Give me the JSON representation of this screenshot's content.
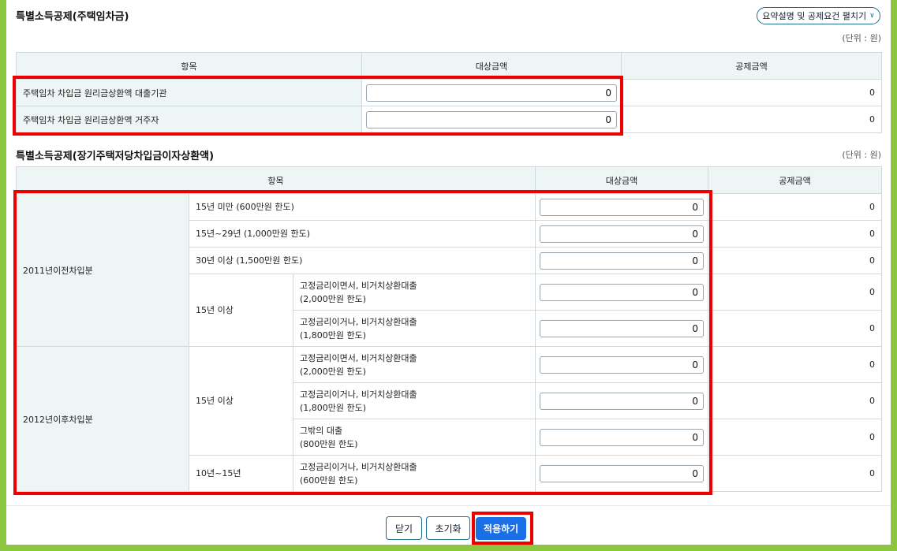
{
  "section1": {
    "title": "특별소득공제(주택임차금)",
    "toggle_label": "요약설명 및 공제요건 펼치기",
    "unit": "(단위 : 원)",
    "headers": [
      "항목",
      "대상금액",
      "공제금액"
    ],
    "rows": [
      {
        "label": "주택임차 차입금 원리금상환액 대출기관",
        "amount": "0",
        "deduction": "0"
      },
      {
        "label": "주택임차 차입금 원리금상환액 거주자",
        "amount": "0",
        "deduction": "0"
      }
    ]
  },
  "section2": {
    "title": "특별소득공제(장기주택저당차입금이자상환액)",
    "unit": "(단위 : 원)",
    "headers": [
      "항목",
      "대상금액",
      "공제금액"
    ],
    "group_2011": "2011년이전차입분",
    "group_2012": "2012년이후차입분",
    "r1": {
      "label": "15년 미만 (600만원 한도)",
      "amount": "0",
      "deduction": "0"
    },
    "r2": {
      "label": "15년~29년 (1,000만원 한도)",
      "amount": "0",
      "deduction": "0"
    },
    "r3": {
      "label": "30년 이상 (1,500만원 한도)",
      "amount": "0",
      "deduction": "0"
    },
    "sub_15_a": "15년 이상",
    "r4": {
      "line1": "고정금리이면서, 비거치상환대출",
      "line2": "(2,000만원 한도)",
      "amount": "0",
      "deduction": "0"
    },
    "r5": {
      "line1": "고정금리이거나, 비거치상환대출",
      "line2": "(1,800만원 한도)",
      "amount": "0",
      "deduction": "0"
    },
    "sub_15_b": "15년 이상",
    "r6": {
      "line1": "고정금리이면서, 비거치상환대출",
      "line2": "(2,000만원 한도)",
      "amount": "0",
      "deduction": "0"
    },
    "r7": {
      "line1": "고정금리이거나, 비거치상환대출",
      "line2": "(1,800만원 한도)",
      "amount": "0",
      "deduction": "0"
    },
    "r8": {
      "line1": "그밖의 대출",
      "line2": "(800만원 한도)",
      "amount": "0",
      "deduction": "0"
    },
    "sub_10": "10년~15년",
    "r9": {
      "line1": "고정금리이거나, 비거치상환대출",
      "line2": "(600만원 한도)",
      "amount": "0",
      "deduction": "0"
    }
  },
  "footer": {
    "close_label": "닫기",
    "reset_label": "초기화",
    "apply_label": "적용하기"
  },
  "colors": {
    "frame": "#8cc63f",
    "highlight": "#ee0000",
    "primary": "#1a6fe6",
    "header_bg": "#eef5f5"
  }
}
